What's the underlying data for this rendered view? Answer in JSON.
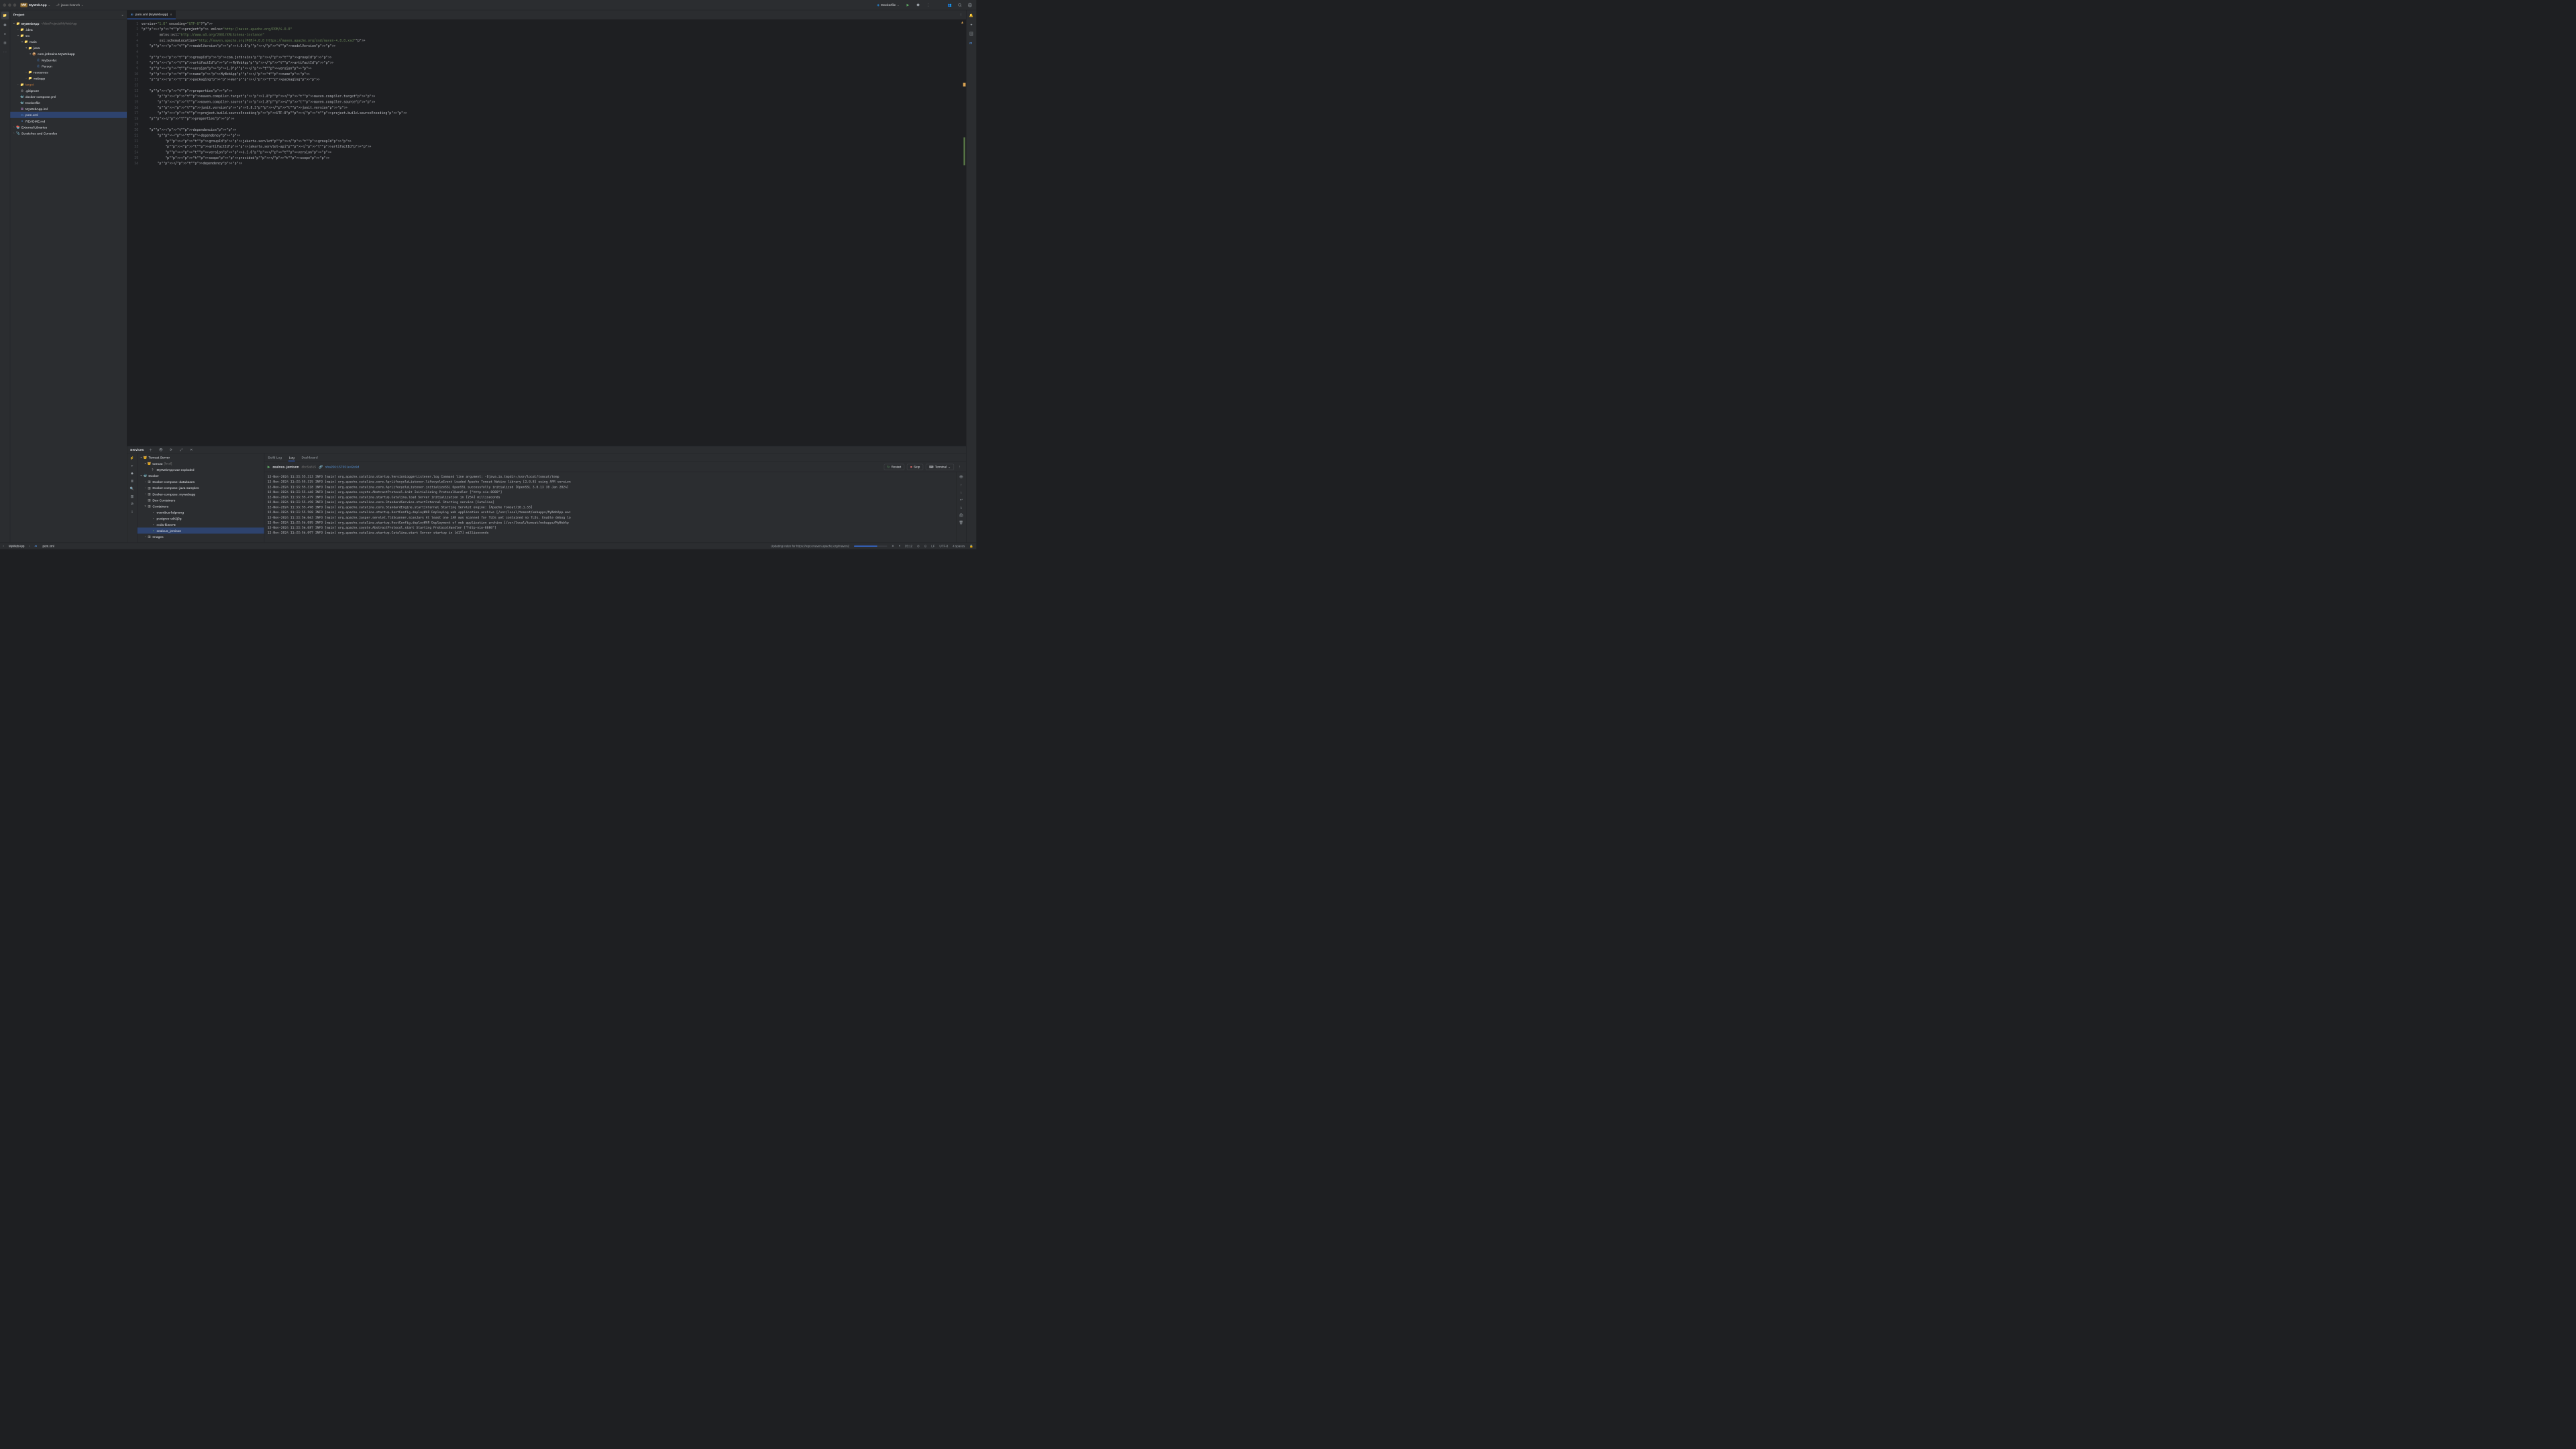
{
  "titlebar": {
    "projectBadge": "MW",
    "projectName": "MyWebApp",
    "branch": "javax-branch",
    "runConfig": "Dockerfile"
  },
  "projectPanel": {
    "title": "Project",
    "tree": [
      {
        "indent": 0,
        "arrow": "▾",
        "icon": "📁",
        "label": "MyWebApp",
        "muted": "~/IdeaProjects/MyWebApp",
        "bold": true
      },
      {
        "indent": 1,
        "arrow": "›",
        "icon": "📁",
        "label": ".idea"
      },
      {
        "indent": 1,
        "arrow": "▾",
        "icon": "📁",
        "label": "src"
      },
      {
        "indent": 2,
        "arrow": "▾",
        "icon": "📁",
        "label": "main"
      },
      {
        "indent": 3,
        "arrow": "▾",
        "icon": "📁",
        "label": "java"
      },
      {
        "indent": 4,
        "arrow": "▾",
        "icon": "📦",
        "label": "com.jetbrains.MyWebapp"
      },
      {
        "indent": 5,
        "arrow": "",
        "icon": "Ⓒ",
        "label": "MyServlet",
        "iconColor": "#4e8bd6"
      },
      {
        "indent": 5,
        "arrow": "",
        "icon": "Ⓒ",
        "label": "Person",
        "iconColor": "#4e8bd6"
      },
      {
        "indent": 3,
        "arrow": "›",
        "icon": "📁",
        "label": "resources"
      },
      {
        "indent": 3,
        "arrow": "›",
        "icon": "📁",
        "label": "webapp"
      },
      {
        "indent": 1,
        "arrow": "›",
        "icon": "📁",
        "label": "target",
        "labelColor": "#c77b3a"
      },
      {
        "indent": 1,
        "arrow": "",
        "icon": "◎",
        "label": ".gitignore"
      },
      {
        "indent": 1,
        "arrow": "",
        "icon": "🐳",
        "label": "docker-compose.yml"
      },
      {
        "indent": 1,
        "arrow": "",
        "icon": "🐳",
        "label": "Dockerfile"
      },
      {
        "indent": 1,
        "arrow": "",
        "icon": "▦",
        "label": "MyWebApp.iml",
        "iconColor": "#9876aa"
      },
      {
        "indent": 1,
        "arrow": "",
        "icon": "m",
        "label": "pom.xml",
        "iconColor": "#4e8bd6",
        "selected": true
      },
      {
        "indent": 1,
        "arrow": "",
        "icon": "▾",
        "label": "README.md",
        "iconColor": "#4e8bd6"
      },
      {
        "indent": 0,
        "arrow": "›",
        "icon": "📚",
        "label": "External Libraries"
      },
      {
        "indent": 0,
        "arrow": "›",
        "icon": "📎",
        "label": "Scratches and Consoles"
      }
    ]
  },
  "editor": {
    "tabLabel": "pom.xml (MyWebApp)",
    "lines": [
      "<?xml version=\"1.0\" encoding=\"UTF-8\"?>",
      "<project xmlns=\"http://maven.apache.org/POM/4.0.0\"",
      "         xmlns:xsi=\"http://www.w3.org/2001/XMLSchema-instance\"",
      "         xsi:schemaLocation=\"http://maven.apache.org/POM/4.0.0 https://maven.apache.org/xsd/maven-4.0.0.xsd\">",
      "    <modelVersion>4.0.0</modelVersion>",
      "",
      "    <groupId>com.jetbrains</groupId>",
      "    <artifactId>MyWebApp</artifactId>",
      "    <version>1.0</version>",
      "    <name>MyWebApp</name>",
      "    <packaging>war</packaging>",
      "",
      "    <properties>",
      "        <maven.compiler.target>1.8</maven.compiler.target>",
      "        <maven.compiler.source>1.8</maven.compiler.source>",
      "        <junit.version>5.8.2</junit.version>",
      "        <project.build.sourceEncoding>UTF-8</project.build.sourceEncoding>",
      "    </properties>",
      "",
      "    <dependencies>",
      "        <dependency>",
      "            <groupId>jakarta.servlet</groupId>",
      "            <artifactId>jakarta.servlet-api</artifactId>",
      "            <version>6.1.0</version>",
      "            <scope>provided</scope>",
      "        </dependency>"
    ]
  },
  "services": {
    "title": "Services",
    "tree": [
      {
        "indent": 0,
        "arrow": "▾",
        "icon": "🐱",
        "label": "Tomcat Server"
      },
      {
        "indent": 1,
        "arrow": "▾",
        "icon": "🐱",
        "label": "tomcat",
        "muted": "[local]"
      },
      {
        "indent": 2,
        "arrow": "",
        "icon": "？",
        "label": "MyWebApp:war exploded"
      },
      {
        "indent": 0,
        "arrow": "▾",
        "icon": "🐳",
        "label": "Docker"
      },
      {
        "indent": 1,
        "arrow": "›",
        "icon": "▥",
        "label": "Docker-compose: databases"
      },
      {
        "indent": 1,
        "arrow": "›",
        "icon": "▥",
        "label": "Docker-compose: java-samples"
      },
      {
        "indent": 1,
        "arrow": "›",
        "icon": "▥",
        "label": "Docker-compose: mywebapp"
      },
      {
        "indent": 1,
        "arrow": "",
        "icon": "▥",
        "label": "Dev Containers"
      },
      {
        "indent": 1,
        "arrow": "▾",
        "icon": "▥",
        "label": "Containers"
      },
      {
        "indent": 2,
        "arrow": "",
        "icon": "▫",
        "label": "eventbus-bdpnsng"
      },
      {
        "indent": 2,
        "arrow": "",
        "icon": "▫",
        "label": "postgres-odr2j3g"
      },
      {
        "indent": 2,
        "arrow": "",
        "icon": "▫",
        "label": "redis-fli2m78"
      },
      {
        "indent": 2,
        "arrow": "",
        "icon": "▪",
        "label": "zealous_jemison",
        "selected": true,
        "iconColor": "#5fad65"
      },
      {
        "indent": 1,
        "arrow": "›",
        "icon": "▥",
        "label": "Images"
      }
    ],
    "tabs": [
      "Build Log",
      "Log",
      "Dashboard"
    ],
    "activeTab": 1,
    "container": {
      "name": "zealous_jemison",
      "shortHash": "dbc5a815",
      "shaLink": "sha256:157651e42e9d"
    },
    "buttons": {
      "restart": "Restart",
      "stop": "Stop",
      "terminal": "Terminal"
    },
    "log": [
      "12-Nov-2024 11:33:55.313 INFO [main] org.apache.catalina.startup.VersionLoggerListener.log Command line argument: -Djava.io.tmpdir=/usr/local/tomcat/temp",
      "12-Nov-2024 11:33:55.315 INFO [main] org.apache.catalina.core.AprLifecycleListener.lifecycleEvent Loaded Apache Tomcat Native library [2.0.8] using APR version",
      "12-Nov-2024 11:33:55.318 INFO [main] org.apache.catalina.core.AprLifecycleListener.initializeSSL OpenSSL successfully initialized [OpenSSL 3.0.13 30 Jan 2024]",
      "12-Nov-2024 11:33:55.468 INFO [main] org.apache.coyote.AbstractProtocol.init Initializing ProtocolHandler [\"http-nio-8080\"]",
      "12-Nov-2024 11:33:55.479 INFO [main] org.apache.catalina.startup.Catalina.load Server initialization in [254] milliseconds",
      "12-Nov-2024 11:33:55.498 INFO [main] org.apache.catalina.core.StandardService.startInternal Starting service [Catalina]",
      "12-Nov-2024 11:33:55.498 INFO [main] org.apache.catalina.core.StandardEngine.startInternal Starting Servlet engine: [Apache Tomcat/10.1.33]",
      "12-Nov-2024 11:33:55.508 INFO [main] org.apache.catalina.startup.HostConfig.deployWAR Deploying web application archive [/usr/local/tomcat/webapps/MyWebApp.war",
      "12-Nov-2024 11:33:56.063 INFO [main] org.apache.jasper.servlet.TldScanner.scanJars At least one JAR was scanned for TLDs yet contained no TLDs. Enable debug lo",
      "12-Nov-2024 11:33:56.085 INFO [main] org.apache.catalina.startup.HostConfig.deployWAR Deployment of web application archive [/usr/local/tomcat/webapps/MyWebAp",
      "12-Nov-2024 11:33:56.087 INFO [main] org.apache.coyote.AbstractProtocol.start Starting ProtocolHandler [\"http-nio-8080\"]",
      "12-Nov-2024 11:33:56.097 INFO [main] org.apache.catalina.startup.Catalina.start Server startup in [617] milliseconds"
    ]
  },
  "statusbar": {
    "crumb1": "MyWebApp",
    "crumb2": "pom.xml",
    "indexing": "Updating index for https://repo.maven.apache.org/maven2",
    "lineCol": "35:12",
    "lineSep": "LF",
    "encoding": "UTF-8",
    "indent": "4 spaces"
  }
}
